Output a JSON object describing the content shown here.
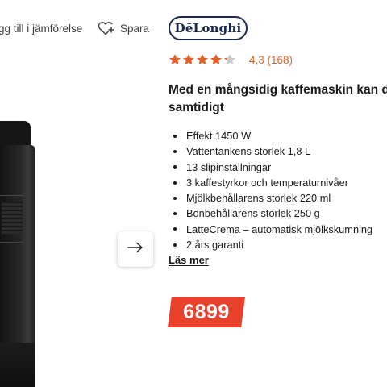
{
  "actions": {
    "compare_label": "gg till i jämförelse",
    "save_label": "Spara"
  },
  "brand": {
    "logo_text": "DēLonghi",
    "color": "#1c2a4d"
  },
  "rating": {
    "stars_filled": 4.3,
    "stars_total": 5,
    "text": "4,3 (168)",
    "star_color": "#e0622a"
  },
  "headline": {
    "line1": "Med en mångsidig kaffemaskin kan d",
    "line2": "samtidigt"
  },
  "features": [
    "Effekt 1450 W",
    "Vattentankens storlek 1,8 L",
    "13 slipinställningar",
    "3 kaffestyrkor och temperaturnivåer",
    "Mjölkbehållarens storlek 220 ml",
    "Bönbehållarens storlek 250 g",
    "LatteCrema – automatisk mjölkskumning",
    "2 års garanti"
  ],
  "read_more_label": "Läs mer",
  "price": {
    "value": "6899",
    "badge_color": "#e8412c"
  },
  "icons": {
    "save": "heart-plus-icon",
    "next": "arrow-right-icon"
  }
}
